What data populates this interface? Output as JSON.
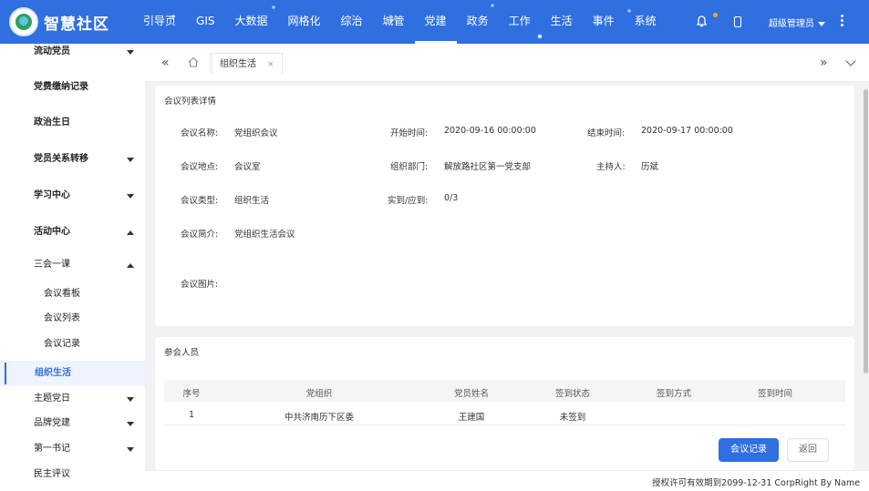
{
  "app": {
    "title": "智慧社区"
  },
  "nav": {
    "items": [
      "引导页",
      "GIS",
      "大数据",
      "网格化",
      "综治",
      "城管",
      "党建",
      "政务",
      "工作",
      "生活",
      "事件",
      "系统"
    ],
    "active": "党建"
  },
  "header": {
    "user": "超级管理员"
  },
  "sidebar": {
    "items": [
      {
        "label": "流动党员",
        "type": "group",
        "arrow": "down"
      },
      {
        "label": "党费缴纳记录",
        "type": "group"
      },
      {
        "label": "政治生日",
        "type": "group"
      },
      {
        "label": "党员关系转移",
        "type": "group",
        "arrow": "down"
      },
      {
        "label": "学习中心",
        "type": "group",
        "arrow": "down"
      },
      {
        "label": "活动中心",
        "type": "group",
        "arrow": "up"
      },
      {
        "label": "三会一课",
        "type": "sub",
        "arrow": "up"
      },
      {
        "label": "会议看板",
        "type": "leaf"
      },
      {
        "label": "会议列表",
        "type": "leaf"
      },
      {
        "label": "会议记录",
        "type": "leaf"
      },
      {
        "label": "组织生活",
        "type": "active"
      },
      {
        "label": "主题党日",
        "type": "sub",
        "arrow": "down"
      },
      {
        "label": "品牌党建",
        "type": "sub",
        "arrow": "down"
      },
      {
        "label": "第一书记",
        "type": "sub",
        "arrow": "down"
      },
      {
        "label": "民主评议",
        "type": "sub"
      }
    ]
  },
  "tabs": {
    "active": "组织生活",
    "close": "×"
  },
  "detail": {
    "title": "会议列表详情",
    "fields": {
      "name_label": "会议名称:",
      "name": "党组织会议",
      "start_label": "开始时间:",
      "start": "2020-09-16 00:00:00",
      "end_label": "结束时间:",
      "end": "2020-09-17 00:00:00",
      "location_label": "会议地点:",
      "location": "会议室",
      "dept_label": "组织部门:",
      "dept": "解放路社区第一党支部",
      "host_label": "主持人:",
      "host": "历斌",
      "type_label": "会议类型:",
      "type": "组织生活",
      "attendance_label": "实到/应到:",
      "attendance": "0/3",
      "intro_label": "会议简介:",
      "intro": "党组织生活会议",
      "images_label": "会议图片:"
    }
  },
  "participants": {
    "title": "参会人员",
    "columns": [
      "序号",
      "党组织",
      "党员姓名",
      "签到状态",
      "签到方式",
      "签到时间"
    ],
    "rows": [
      [
        "1",
        "中共济南历下区委",
        "王建国",
        "未签到",
        "",
        ""
      ]
    ]
  },
  "buttons": {
    "records": "会议记录",
    "back": "返回"
  },
  "footer": {
    "text": "授权许可有效期到2099-12-31 CorpRight By Name"
  },
  "colors": {
    "primary": "#2f6fe0"
  }
}
